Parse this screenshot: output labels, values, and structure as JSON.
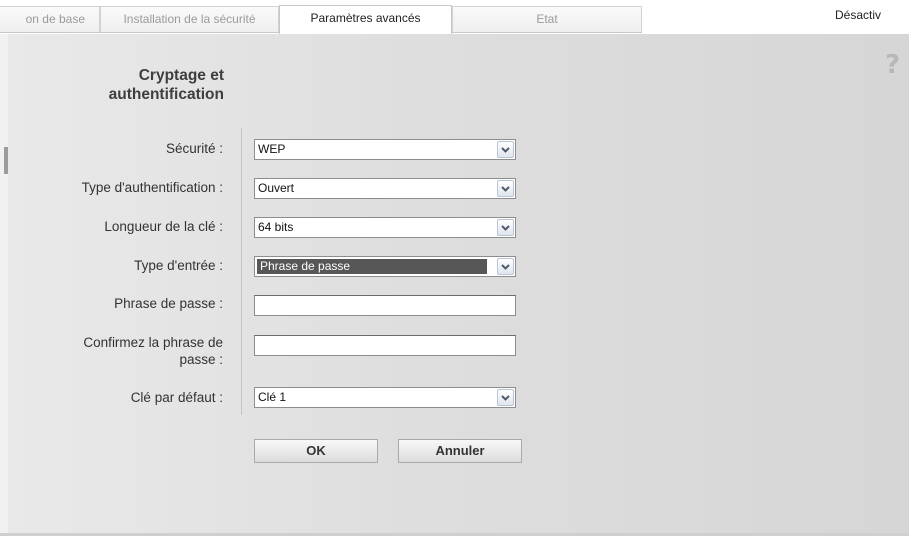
{
  "tabs": [
    {
      "label": "on de base"
    },
    {
      "label": "Installation de la sécurité"
    },
    {
      "label": "Paramètres avancés"
    },
    {
      "label": "Etat"
    }
  ],
  "header": {
    "disable_label": "Désactiv"
  },
  "help": {
    "glyph": "?"
  },
  "section": {
    "title_line1": "Cryptage et",
    "title_line2": "authentification"
  },
  "form": {
    "security": {
      "label": "Sécurité :",
      "value": "WEP"
    },
    "auth_type": {
      "label": "Type d'authentification :",
      "value": "Ouvert"
    },
    "key_length": {
      "label": "Longueur de la clé :",
      "value": "64 bits"
    },
    "input_type": {
      "label": "Type d'entrée :",
      "value": "Phrase de passe"
    },
    "passphrase": {
      "label": "Phrase de passe :",
      "value": ""
    },
    "confirm_passphrase": {
      "label_line1": "Confirmez la phrase de",
      "label_line2": "passe :",
      "value": ""
    },
    "default_key": {
      "label": "Clé par défaut :",
      "value": "Clé 1"
    }
  },
  "buttons": {
    "ok": "OK",
    "cancel": "Annuler"
  },
  "colors": {
    "panel": "#dedede",
    "select_highlight": "#575757",
    "dropdown_button_border": "#b9c4d4"
  }
}
